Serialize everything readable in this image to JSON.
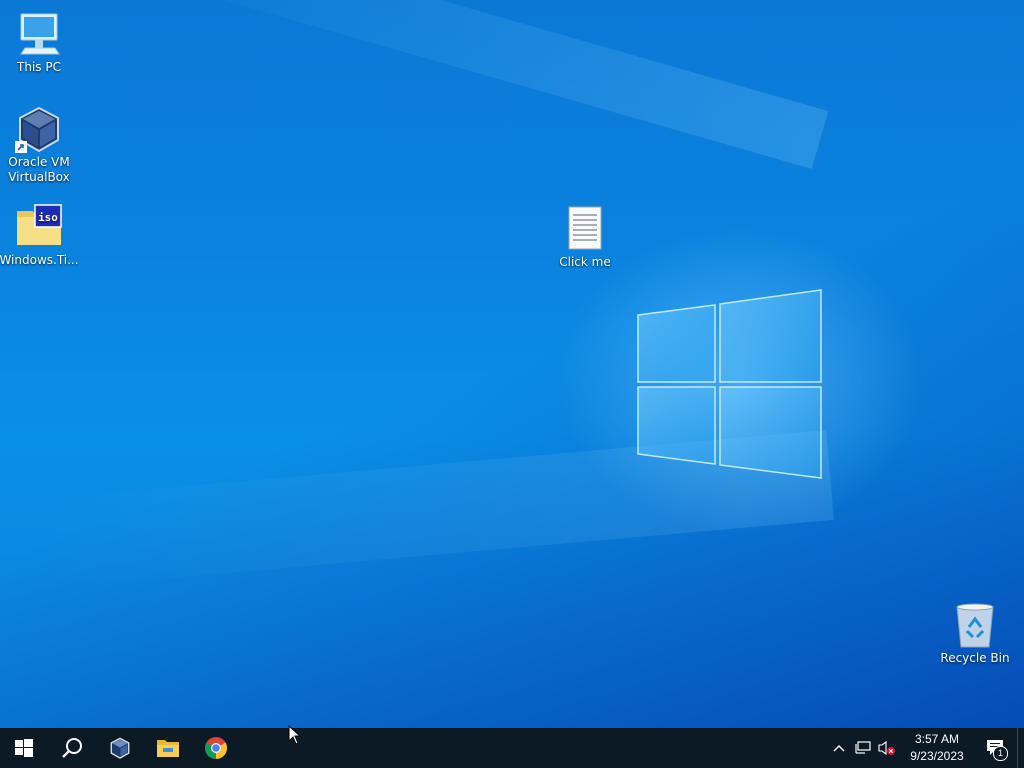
{
  "desktop": {
    "icons": [
      {
        "label": "This PC",
        "icon": "this-pc-icon"
      },
      {
        "label": "Oracle VM VirtualBox",
        "icon": "virtualbox-icon"
      },
      {
        "label": "Windows.Ti...",
        "icon": "iso-file-icon"
      },
      {
        "label": "Click me",
        "icon": "text-document-icon"
      },
      {
        "label": "Recycle Bin",
        "icon": "recycle-bin-icon"
      }
    ],
    "wallpaper_color": "#0a83df"
  },
  "taskbar": {
    "buttons": [
      {
        "name": "start",
        "icon": "windows-logo-icon"
      },
      {
        "name": "search",
        "icon": "search-icon"
      },
      {
        "name": "virtualbox",
        "icon": "virtualbox-icon"
      },
      {
        "name": "file-explorer",
        "icon": "folder-icon"
      },
      {
        "name": "chrome",
        "icon": "chrome-icon"
      }
    ],
    "tray": {
      "time": "3:57 AM",
      "date": "9/23/2023",
      "notification_count": "1"
    },
    "background": "#0c1a26"
  }
}
